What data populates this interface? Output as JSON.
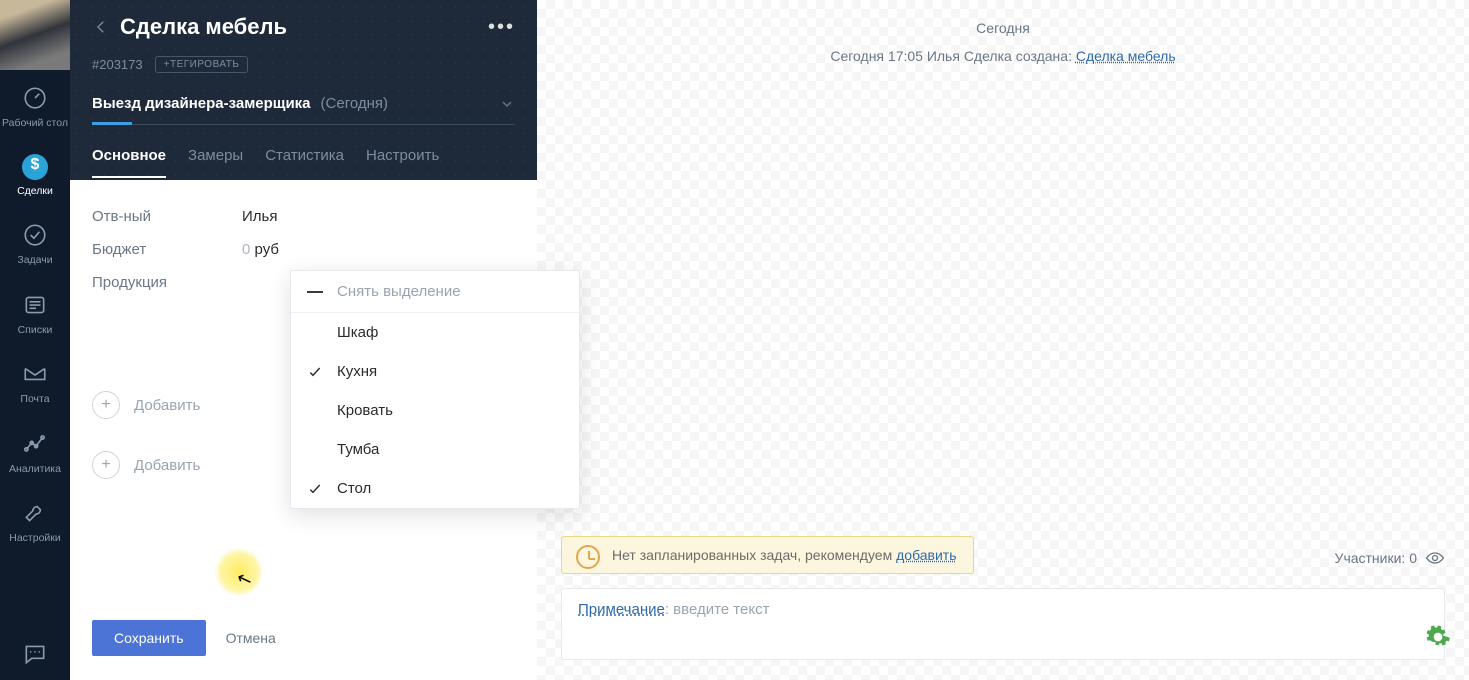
{
  "rail": {
    "items": [
      {
        "label": "Рабочий стол"
      },
      {
        "label": "Сделки"
      },
      {
        "label": "Задачи"
      },
      {
        "label": "Списки"
      },
      {
        "label": "Почта"
      },
      {
        "label": "Аналитика"
      },
      {
        "label": "Настройки"
      }
    ]
  },
  "deal": {
    "title": "Сделка мебель",
    "id": "#203173",
    "tag_button": "+ТЕГИРОВАТЬ",
    "stage_name": "Выезд дизайнера-замерщика",
    "stage_date": "(Сегодня)",
    "tabs": [
      {
        "label": "Основное"
      },
      {
        "label": "Замеры"
      },
      {
        "label": "Статистика"
      },
      {
        "label": "Настроить"
      }
    ],
    "fields": {
      "responsible_label": "Отв-ный",
      "responsible_value": "Илья",
      "budget_label": "Бюджет",
      "budget_value": "0",
      "budget_currency": "руб",
      "products_label": "Продукция"
    },
    "add_contact_label": "Добавить",
    "add_company_label": "Добавить",
    "save_label": "Сохранить",
    "cancel_label": "Отмена"
  },
  "dropdown": {
    "clear_label": "Снять выделение",
    "options": [
      {
        "label": "Шкаф",
        "checked": false
      },
      {
        "label": "Кухня",
        "checked": true
      },
      {
        "label": "Кровать",
        "checked": false
      },
      {
        "label": "Тумба",
        "checked": false
      },
      {
        "label": "Стол",
        "checked": true
      }
    ]
  },
  "feed": {
    "day_label": "Сегодня",
    "event_prefix": "Сегодня 17:05 Илья  Сделка создана:",
    "event_link": "Сделка мебель",
    "task_banner_text": "Нет запланированных задач, рекомендуем ",
    "task_banner_link": "добавить",
    "participants_label": "Участники: 0",
    "note_label": "Примечание",
    "note_separator": ": ",
    "note_placeholder": "введите текст"
  }
}
